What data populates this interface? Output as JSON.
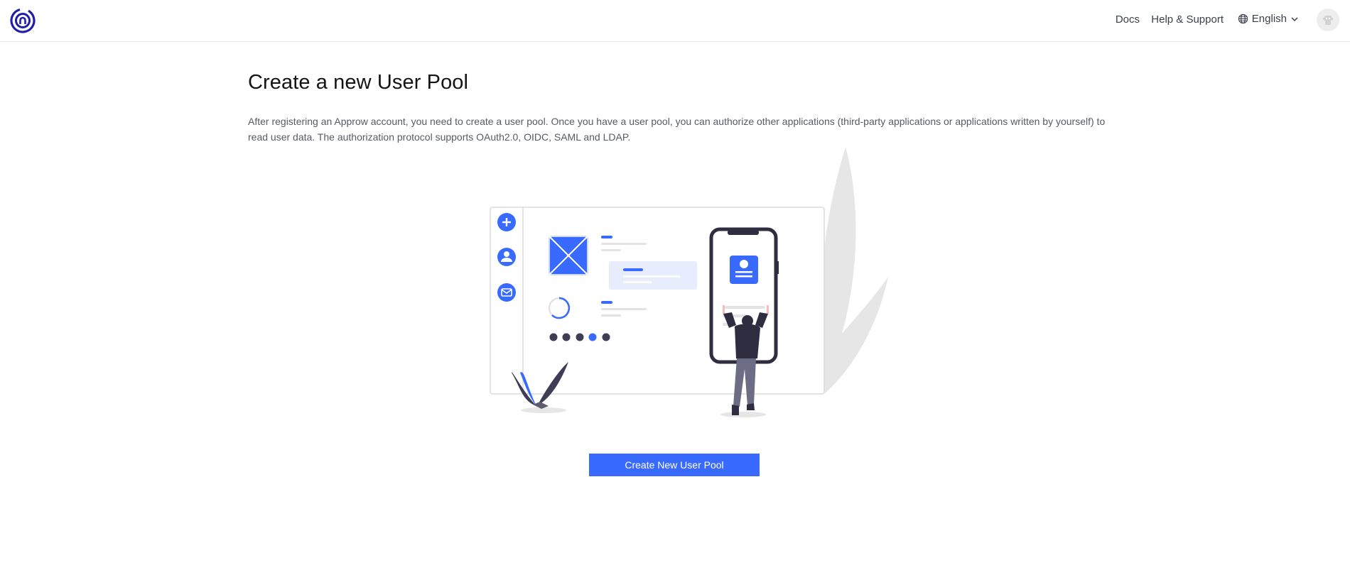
{
  "header": {
    "logo_icon": "approw-logo-icon",
    "nav": {
      "docs": "Docs",
      "help": "Help & Support",
      "language": "English"
    },
    "avatar_icon": "user-avatar-icon"
  },
  "main": {
    "title": "Create a new User Pool",
    "description": "After registering an Approw account, you need to create a user pool. Once you have a user pool, you can authorize other applications (third-party applications or applications written by yourself) to read user data. The authorization protocol supports OAuth2.0, OIDC, SAML and LDAP.",
    "create_button": "Create New User Pool"
  },
  "colors": {
    "accent": "#396aff",
    "logo": "#1f1fa8",
    "dark_figure": "#2f2e41",
    "text_muted": "#555b66"
  }
}
